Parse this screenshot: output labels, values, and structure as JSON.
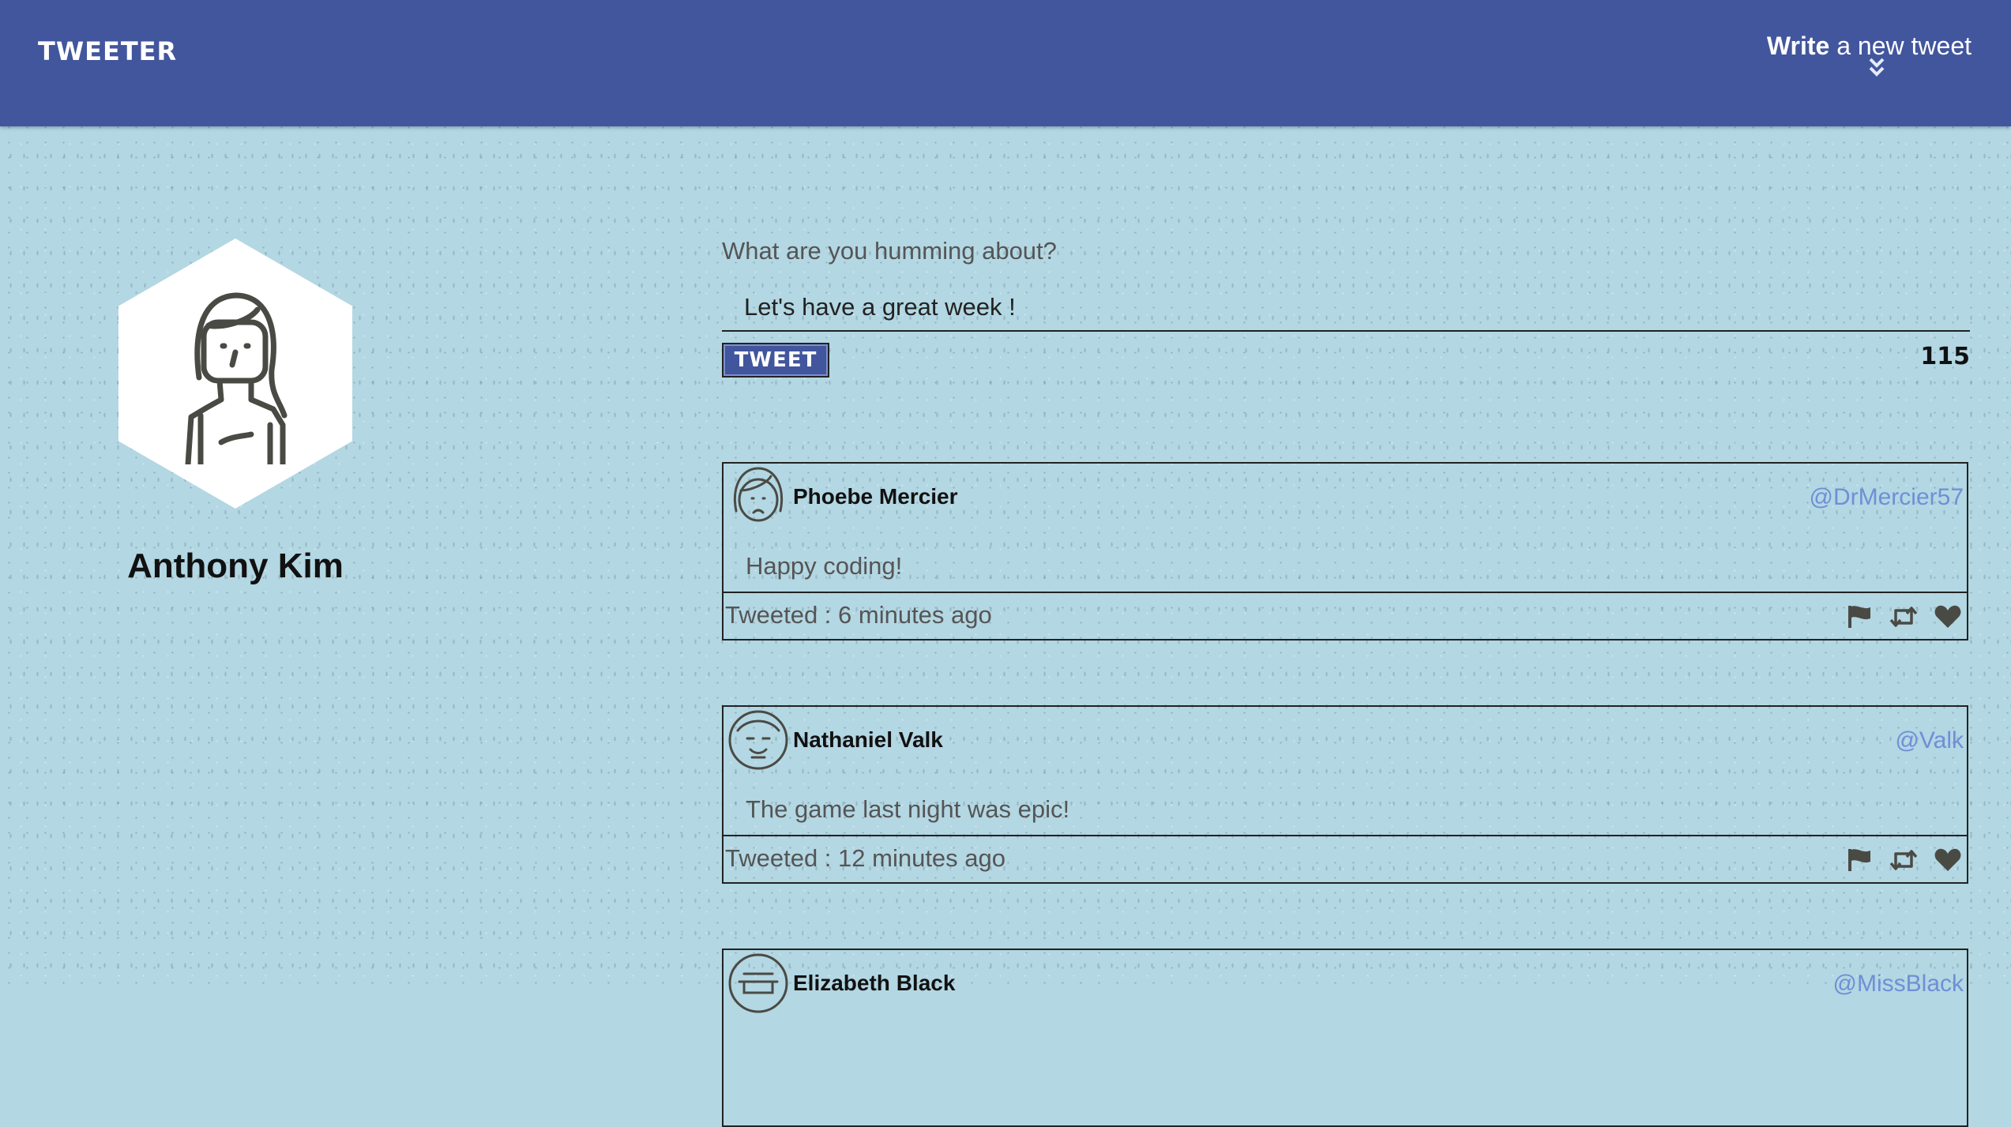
{
  "header": {
    "brand": "TWEETER",
    "compose_bold": "Write",
    "compose_rest": " a new tweet"
  },
  "profile": {
    "name": "Anthony Kim"
  },
  "composer": {
    "label": "What are you humming about?",
    "value": "Let's have a great week !",
    "button": "TWEET",
    "counter": "115"
  },
  "tweets": [
    {
      "name": "Phoebe Mercier",
      "handle": "@DrMercier57",
      "text": "Happy coding!",
      "time": "Tweeted : 6 minutes ago"
    },
    {
      "name": "Nathaniel Valk",
      "handle": "@Valk",
      "text": "The game last night was epic!",
      "time": "Tweeted : 12 minutes ago"
    },
    {
      "name": "Elizabeth Black",
      "handle": "@MissBlack",
      "text": "",
      "time": ""
    }
  ],
  "icons": {
    "chevron": "double-chevron-down-icon",
    "flag": "flag-icon",
    "retweet": "retweet-icon",
    "heart": "heart-icon"
  },
  "colors": {
    "header": "#42569d",
    "background": "#b3d7e3",
    "handle": "#6f8fd6"
  }
}
